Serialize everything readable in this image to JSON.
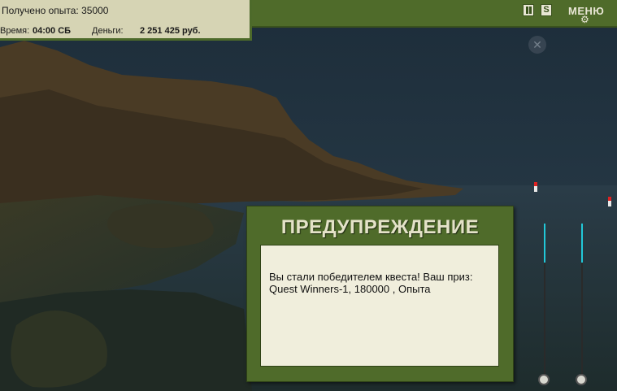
{
  "hud": {
    "experience_label": "Получено опыта: 35000",
    "time_label": "Время:",
    "time_value": "04:00 СБ",
    "money_label": "Деньги:",
    "money_value": "2 251 425 руб."
  },
  "toolbar": {
    "sound_label": "S",
    "menu_label": "МЕНЮ"
  },
  "dialog": {
    "title": "ПРЕДУПРЕЖДЕНИЕ",
    "message_line1": "Вы стали победителем квеста! Ваш приз:",
    "message_line2": "Quest Winners-1, 180000 , Опыта"
  },
  "icons": [
    "pause-icon",
    "sound-icon",
    "gear-icon",
    "compass-icon",
    "float-icon",
    "fishing-rod-icon"
  ],
  "colors": {
    "panel_green": "#4f6b2a",
    "info_bg": "#d6d4b4",
    "dialog_body": "#f0eedc",
    "rod_tip": "#22c8d8"
  }
}
